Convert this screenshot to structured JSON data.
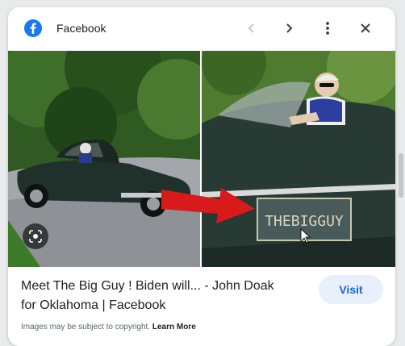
{
  "header": {
    "site_name": "Facebook",
    "prev_icon": "chevron-left-icon",
    "next_icon": "chevron-right-icon",
    "more_icon": "more-vert-icon",
    "close_icon": "close-icon"
  },
  "image": {
    "plate_text": "THEBIGGUY",
    "lens_icon": "lens-icon",
    "arrow_color": "#d91a1a"
  },
  "result": {
    "title_line1": "Meet The Big Guy ! Biden will... - John Doak",
    "title_line2": "for Oklahoma | Facebook",
    "visit_label": "Visit"
  },
  "footer": {
    "copyright_text": "Images may be subject to copyright.",
    "learn_more": "Learn More"
  },
  "colors": {
    "facebook_blue": "#1877f2",
    "visit_bg": "#e8f0fe",
    "visit_text": "#1967d2"
  }
}
